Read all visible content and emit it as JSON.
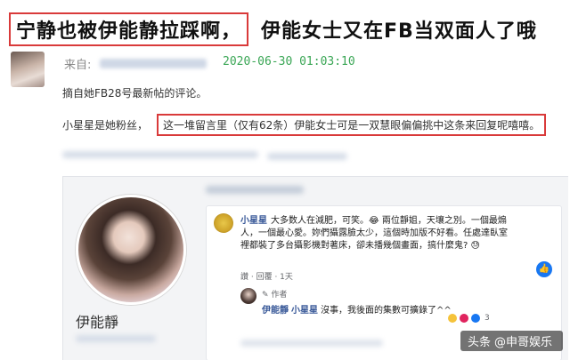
{
  "headline": {
    "boxed": "宁静也被伊能静拉踩啊，",
    "rest": "伊能女士又在FB当双面人了哦"
  },
  "post": {
    "from_label": "来自:",
    "time": "2020-06-30 01:03:10",
    "excerpt": "摘自她FB28号最新帖的评论。",
    "fan_text": "小星星是她粉丝，",
    "highlight": "这一堆留言里（仅有62条）伊能女士可是一双慧眼偏偏挑中这条来回复呢嘻嘻。"
  },
  "fb": {
    "profile_name": "伊能靜",
    "comment": {
      "author": "小星星",
      "text": "大多数人在減肥，可笑。😂 兩位靜姐，天壤之別。一個最煽人，一個最心愛。妳們攝露臉太少，這個時加版不好看。任處達臥室裡都裝了多台攝影機對著床，卻未播幾個畫面，搞什麼鬼? 😓",
      "actions": "讚 · 回覆 · 1天",
      "react_icon": "thumbs-up"
    },
    "reply": {
      "badge": "作者",
      "author": "伊能靜",
      "mention": "小星星",
      "text": "沒事，我後面的集數可擴錄了^^",
      "react_count": "3",
      "react_colors": [
        "#f5c33b",
        "#e0245e",
        "#1877f2"
      ]
    }
  },
  "watermark": {
    "platform": "头条",
    "account": "@申哥娱乐"
  }
}
